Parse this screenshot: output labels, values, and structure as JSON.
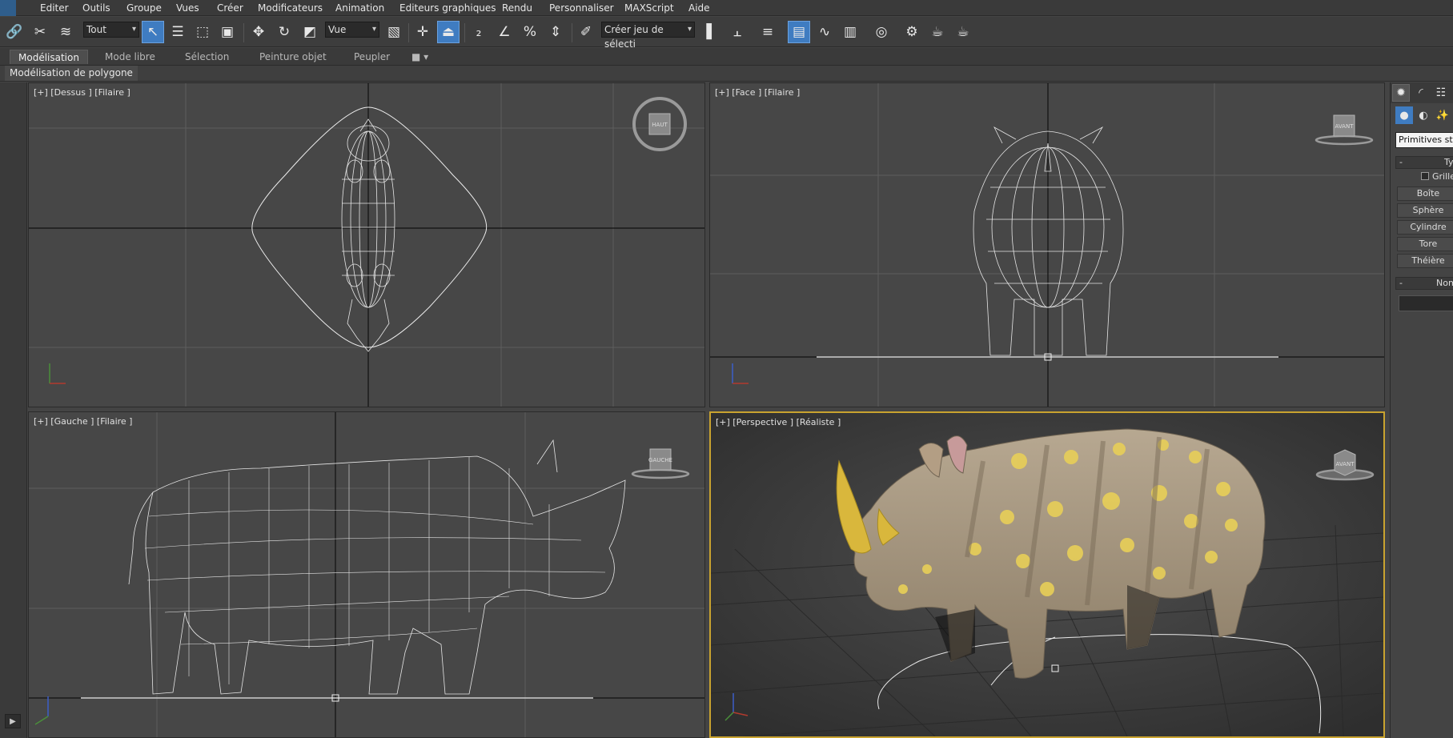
{
  "menubar": {
    "items": [
      "Editer",
      "Outils",
      "Groupe",
      "Vues",
      "Créer",
      "Modificateurs",
      "Animation",
      "Editeurs graphiques",
      "Rendu",
      "Personnaliser",
      "MAXScript",
      "Aide"
    ]
  },
  "toolbar": {
    "selection_filter": "Tout",
    "reference_coord": "Vue",
    "named_selection_placeholder": "Créer jeu de sélecti"
  },
  "ribbon": {
    "tabs": [
      "Modélisation",
      "Mode libre",
      "Sélection",
      "Peinture objet",
      "Peupler"
    ],
    "active_tab": "Modélisation",
    "sub_label": "Modélisation de polygone"
  },
  "viewports": {
    "top": {
      "label": "[+] [Dessus ] [Filaire ]",
      "cube": "HAUT"
    },
    "front": {
      "label": "[+] [Face ] [Filaire ]",
      "cube": "AVANT"
    },
    "left": {
      "label": "[+] [Gauche ] [Filaire ]",
      "cube": "GAUCHE"
    },
    "perspective": {
      "label": "[+] [Perspective ] [Réaliste ]",
      "cube": "AVANT"
    }
  },
  "command_panel": {
    "dropdown": "Primitives stan",
    "type_rollout": "Type",
    "grid_label": "Grille",
    "primitives": [
      "Boîte",
      "Sphère",
      "Cylindre",
      "Tore",
      "Théière"
    ],
    "name_rollout": "Nom e"
  },
  "colors": {
    "accent_blue": "#3f7cc1",
    "active_viewport_border": "#c9a32f",
    "viewport_bg": "#474747"
  }
}
